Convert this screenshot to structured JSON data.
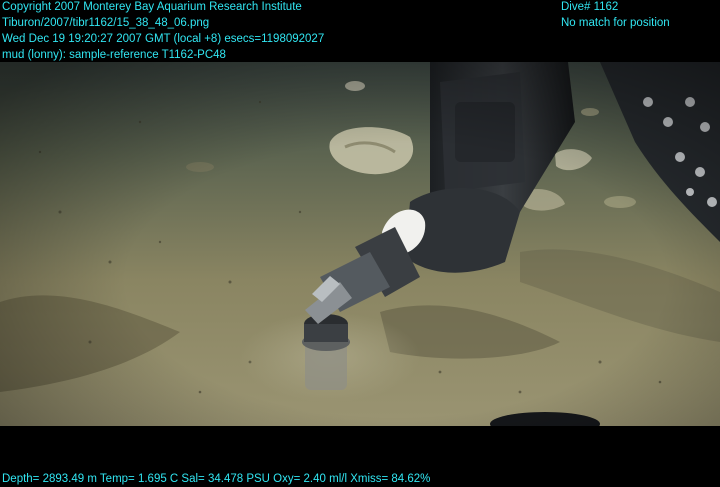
{
  "overlay": {
    "top_left": [
      "Copyright 2007 Monterey Bay Aquarium Research Institute",
      "Tiburon/2007/tibr1162/15_38_48_06.png",
      "Wed Dec 19 19:20:27 2007 GMT (local +8)  esecs=1198092027",
      "mud (lonny): sample-reference T1162-PC48"
    ],
    "top_right": [
      "Dive# 1162",
      "No match for position"
    ],
    "bottom": "Depth= 2893.49 m  Temp= 1.695 C  Sal= 34.478 PSU  Oxy= 2.40 ml/l  Xmiss= 84.62%"
  },
  "colors": {
    "overlay_text": "#31e6f2",
    "letterbox": "#000000",
    "seafloor": "#8a8560"
  }
}
